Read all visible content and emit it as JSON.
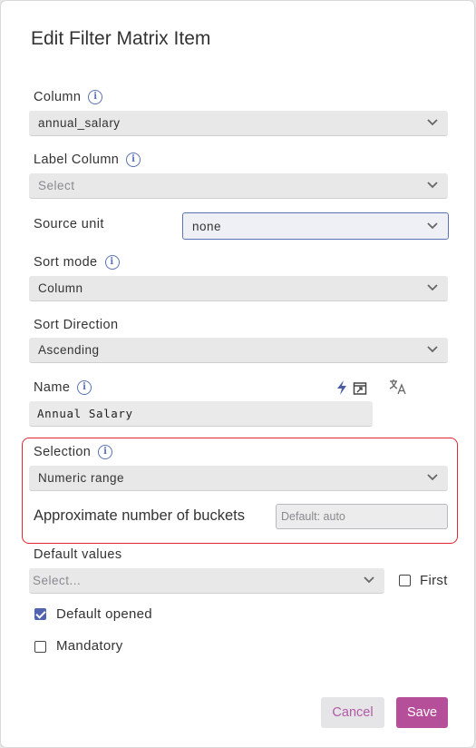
{
  "dialog": {
    "title": "Edit Filter Matrix Item",
    "column": {
      "label": "Column",
      "value": "annual_salary"
    },
    "label_column": {
      "label": "Label Column",
      "placeholder": "Select"
    },
    "source_unit": {
      "label": "Source unit",
      "value": "none"
    },
    "sort_mode": {
      "label": "Sort mode",
      "value": "Column"
    },
    "sort_direction": {
      "label": "Sort Direction",
      "value": "Ascending"
    },
    "name": {
      "label": "Name",
      "value": "Annual Salary"
    },
    "selection": {
      "label": "Selection",
      "value": "Numeric range"
    },
    "buckets": {
      "label": "Approximate number of buckets",
      "placeholder": "Default: auto"
    },
    "default_values": {
      "label": "Default values",
      "placeholder": "Select...",
      "first_label": "First",
      "first_checked": false
    },
    "default_opened": {
      "label": "Default opened",
      "checked": true
    },
    "mandatory": {
      "label": "Mandatory",
      "checked": false
    },
    "buttons": {
      "cancel": "Cancel",
      "save": "Save"
    },
    "icons": {
      "info": "info-icon",
      "chevron": "chevron-down-icon",
      "lightning": "lightning-icon",
      "expression": "expression-editor-icon",
      "translate": "translate-icon"
    },
    "colors": {
      "accent": "#b64f9a",
      "focus": "#5a72b5",
      "highlight": "#e0262e"
    }
  }
}
